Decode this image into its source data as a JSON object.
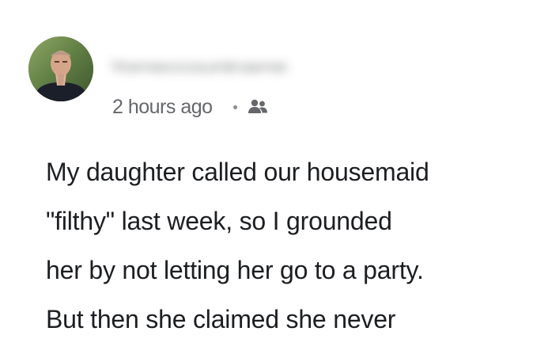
{
  "post": {
    "author": {
      "name": "Yomeccountname",
      "avatar_icon": "avatar-photo"
    },
    "timestamp": "2 hours ago",
    "separator": "•",
    "audience_icon": "friends-audience-icon",
    "text_lines": [
      "My daughter called our housemaid",
      "\"filthy\" last week, so I grounded",
      "her by not letting her go to a party.",
      "But then she claimed she never"
    ]
  },
  "colors": {
    "text_primary": "#1c1e21",
    "text_secondary": "#65676b",
    "background": "#ffffff"
  }
}
